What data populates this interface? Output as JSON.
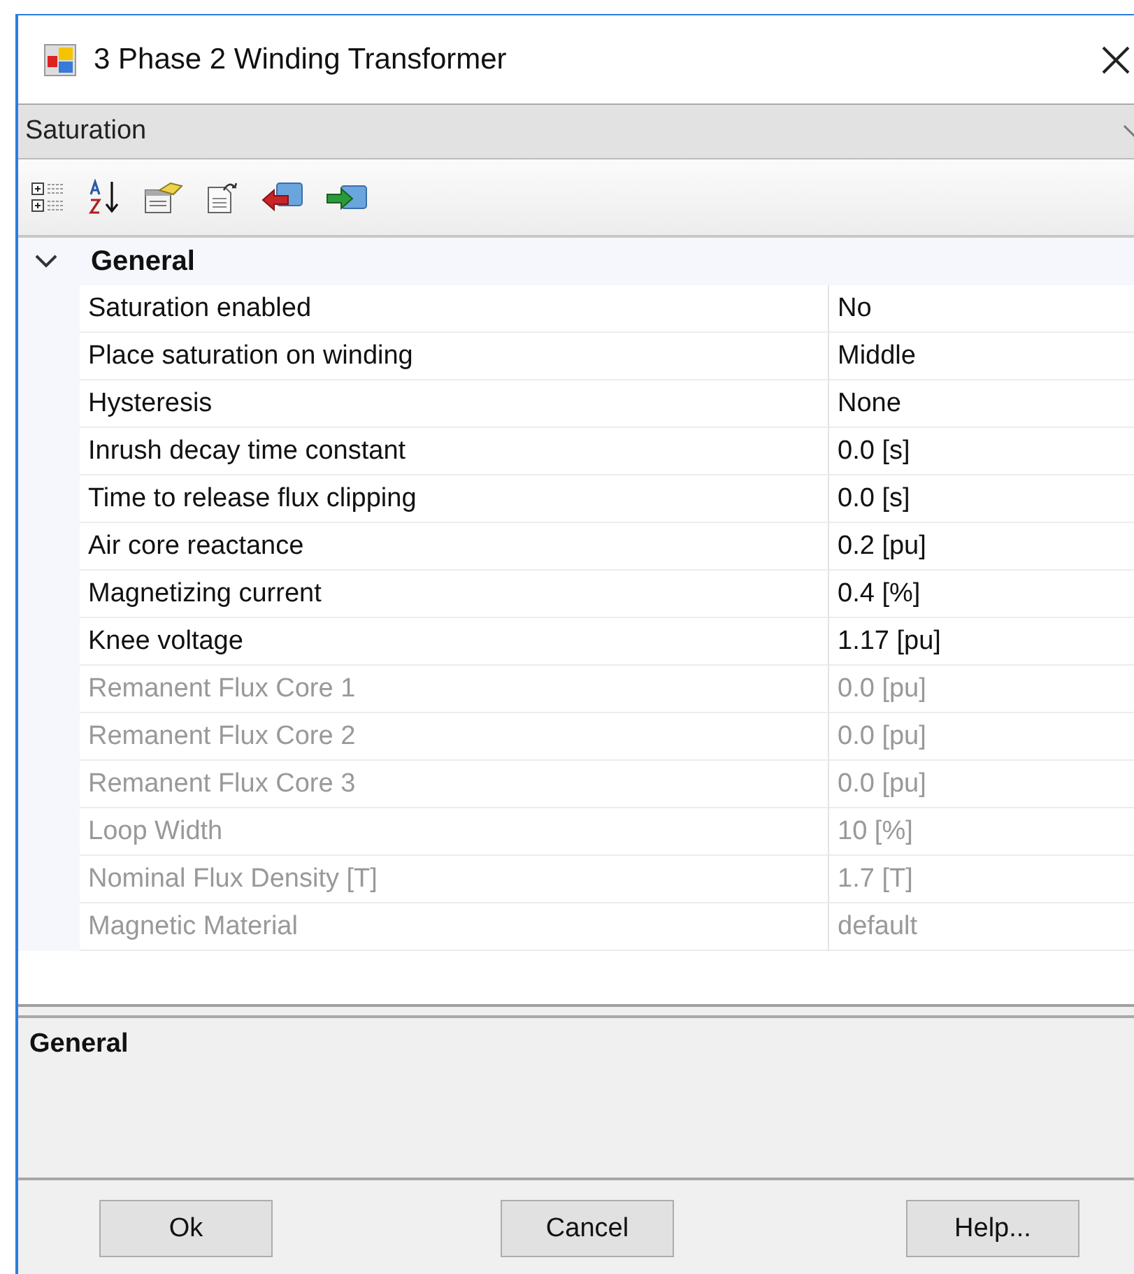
{
  "window": {
    "title": "3 Phase 2 Winding Transformer"
  },
  "category_dropdown": {
    "value": "Saturation"
  },
  "property_grid": {
    "group": {
      "label": "General",
      "expanded": true
    },
    "rows": [
      {
        "name": "Saturation enabled",
        "value": "No",
        "disabled": false
      },
      {
        "name": "Place saturation on winding",
        "value": "Middle",
        "disabled": false
      },
      {
        "name": "Hysteresis",
        "value": "None",
        "disabled": false
      },
      {
        "name": "Inrush decay time constant",
        "value": "0.0 [s]",
        "disabled": false
      },
      {
        "name": "Time to release flux clipping",
        "value": "0.0 [s]",
        "disabled": false
      },
      {
        "name": "Air core reactance",
        "value": "0.2 [pu]",
        "disabled": false
      },
      {
        "name": "Magnetizing current",
        "value": "0.4 [%]",
        "disabled": false
      },
      {
        "name": "Knee voltage",
        "value": "1.17 [pu]",
        "disabled": false
      },
      {
        "name": "Remanent Flux Core 1",
        "value": "0.0 [pu]",
        "disabled": true
      },
      {
        "name": "Remanent Flux Core 2",
        "value": "0.0 [pu]",
        "disabled": true
      },
      {
        "name": "Remanent Flux Core 3",
        "value": "0.0 [pu]",
        "disabled": true
      },
      {
        "name": "Loop Width",
        "value": "10 [%]",
        "disabled": true
      },
      {
        "name": "Nominal Flux Density [T]",
        "value": "1.7 [T]",
        "disabled": true
      },
      {
        "name": "Magnetic Material",
        "value": "default",
        "disabled": true
      }
    ]
  },
  "description": {
    "title": "General"
  },
  "buttons": [
    "Ok",
    "Cancel",
    "Help..."
  ]
}
